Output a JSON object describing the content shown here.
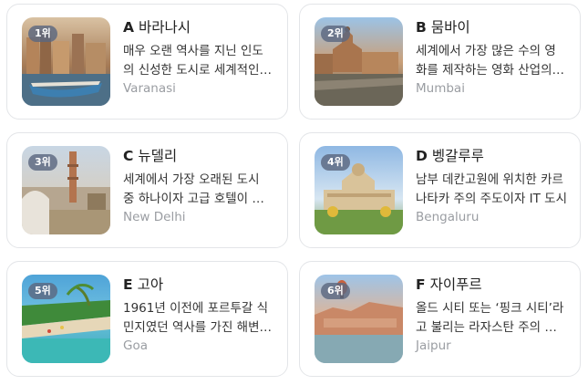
{
  "cards": [
    {
      "rank": "1위",
      "letter": "A",
      "name": "바라나시",
      "desc": "매우 오랜 역사를 지닌 인도의 신성한 도시로 세계적인 순례지",
      "eng": "Varanasi",
      "image": "varanasi-ghats-photo"
    },
    {
      "rank": "2위",
      "letter": "B",
      "name": "뭄바이",
      "desc": "세계에서 가장 많은 수의 영화를 제작하는 영화 산업의 중심지",
      "eng": "Mumbai",
      "image": "mumbai-station-photo"
    },
    {
      "rank": "3위",
      "letter": "C",
      "name": "뉴델리",
      "desc": "세계에서 가장 오래된 도시 중 하나이자 고급 호텔이 많은 수도",
      "eng": "New Delhi",
      "image": "new-delhi-minaret-photo"
    },
    {
      "rank": "4위",
      "letter": "D",
      "name": "벵갈루루",
      "desc": "남부 데칸고원에 위치한 카르나타카 주의 주도이자 IT 도시",
      "eng": "Bengaluru",
      "image": "bengaluru-palace-photo"
    },
    {
      "rank": "5위",
      "letter": "E",
      "name": "고아",
      "desc": "1961년 이전에 포르투갈 식민지였던 역사를 가진 해변 휴양지",
      "eng": "Goa",
      "image": "goa-beach-photo"
    },
    {
      "rank": "6위",
      "letter": "F",
      "name": "자이푸르",
      "desc": "올드 시티 또는 ‘핑크 시티’라고 불리는 라자스탄 주의 주도",
      "eng": "Jaipur",
      "image": "jaipur-fort-photo"
    }
  ]
}
